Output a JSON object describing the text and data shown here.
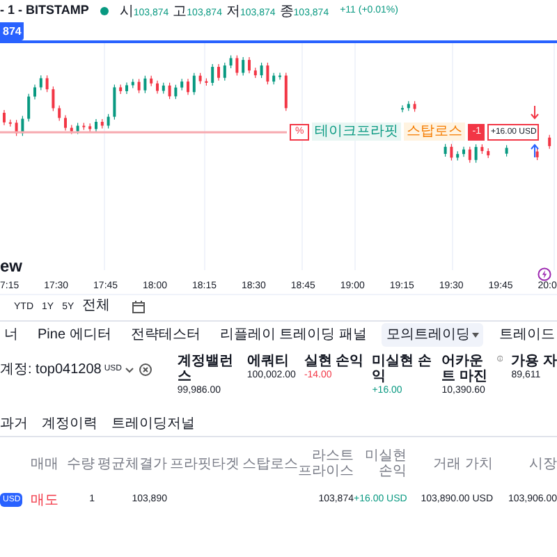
{
  "symbol_header": {
    "title": "- 1 - BITSTAMP",
    "market_open": true,
    "ohlc": [
      {
        "label": "시",
        "value": "103,874"
      },
      {
        "label": "고",
        "value": "103,874"
      },
      {
        "label": "저",
        "value": "103,874"
      },
      {
        "label": "종",
        "value": "103,874"
      }
    ],
    "change": "+11 (+0.01%)"
  },
  "price_tag": "874",
  "position_line": {
    "percent_button": "%",
    "take_profit": "테이크프라핏",
    "stop_loss": "스탑로스",
    "quantity": "-1",
    "pnl": "+16.00 USD"
  },
  "logo_text": "ew",
  "time_axis": [
    "7:15",
    "17:30",
    "17:45",
    "18:00",
    "18:15",
    "18:30",
    "18:45",
    "19:00",
    "19:15",
    "19:30",
    "19:45",
    "20:0"
  ],
  "date_ranges": [
    "YTD",
    "1Y",
    "5Y",
    "전체"
  ],
  "bottom_tabs": [
    {
      "label": "너",
      "selected": false
    },
    {
      "label": "Pine 에디터",
      "selected": false
    },
    {
      "label": "전략테스터",
      "selected": false
    },
    {
      "label": "리플레이 트레이딩 패널",
      "selected": false
    },
    {
      "label": "모의트레이딩",
      "selected": true,
      "dropdown": true
    },
    {
      "label": "트레이드",
      "selected": false
    }
  ],
  "account": {
    "label": "계정: top041208",
    "currency": "USD"
  },
  "metrics": [
    {
      "label": "계정밸런스",
      "value": "99,986.00",
      "color": "#131722"
    },
    {
      "label": "에쿼티",
      "value": "100,002.00",
      "color": "#131722"
    },
    {
      "label": "실현 손익",
      "value": "-14.00",
      "color": "#f23645"
    },
    {
      "label": "미실현 손익",
      "value": "+16.00",
      "color": "#089981"
    },
    {
      "label": "어카운트 마진",
      "value": "10,390.60",
      "color": "#131722",
      "info": true
    },
    {
      "label": "가용 자",
      "value": "89,611",
      "color": "#131722"
    }
  ],
  "sub_tabs": [
    "과거",
    "계정이력",
    "트레이딩저널"
  ],
  "table": {
    "columns": [
      "매매",
      "수량",
      "평균체결가",
      "프라핏타겟",
      "스탑로스",
      "라스트 프라이스",
      "미실현 손익",
      "거래 가치",
      "시장"
    ],
    "rows": [
      {
        "badge": "USD",
        "side": {
          "text": "매도",
          "kind": "sell"
        },
        "quantity": "1",
        "avg_price": "103,890",
        "last_price": "103,874",
        "unrealized_pnl": {
          "text": "+16.00 USD",
          "color": "#089981"
        },
        "trade_value": "103,890.00 USD",
        "market": "103,906.00"
      }
    ]
  }
}
